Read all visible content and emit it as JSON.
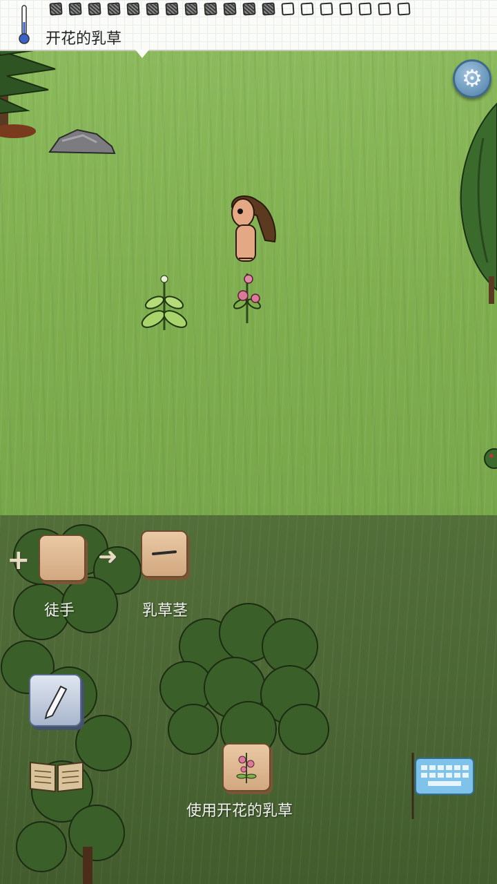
{
  "status": {
    "object_name": "开花的乳草",
    "food_pips_total": 19,
    "food_pips_full": 12
  },
  "settings": {
    "icon": "gear-icon"
  },
  "scene": {
    "objects": [
      "pine-tree",
      "big-rock",
      "milkweed",
      "flowering-milkweed",
      "juniper-tree",
      "player-character"
    ]
  },
  "crafting": {
    "source_label": "徒手",
    "result_label": "乳草茎",
    "action_label": "使用开花的乳草"
  },
  "controls": {
    "pencil": "pencil-icon",
    "book": "book-icon",
    "keyboard": "keyboard-icon"
  },
  "colors": {
    "grass": "#86b556",
    "panel": "#4a6533",
    "tile": "#d9b28a",
    "settings": "#4c7ea6"
  }
}
